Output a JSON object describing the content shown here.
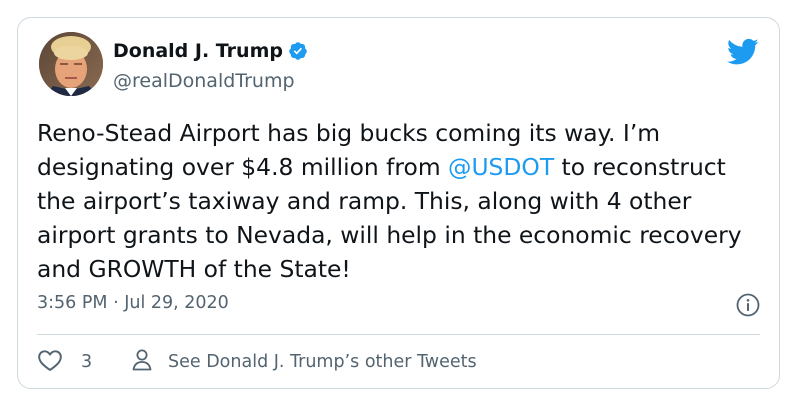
{
  "author": {
    "name": "Donald J. Trump",
    "handle": "@realDonaldTrump",
    "verified": true
  },
  "tweet": {
    "text_before": "Reno-Stead Airport has big bucks coming its way. I’m designating over $4.8 million from ",
    "mention": "@USDOT",
    "text_after": " to reconstruct the airport’s taxiway and ramp. This, along with 4 other airport grants to Nevada, will help in the economic recovery and GROWTH of the State!"
  },
  "meta": {
    "timestamp": "3:56 PM · Jul 29, 2020"
  },
  "actions": {
    "like_count": "3",
    "other_tweets_label": "See Donald J. Trump’s other Tweets"
  },
  "colors": {
    "accent": "#1d9bf0",
    "text": "#0f1419",
    "muted": "#536471",
    "border": "#cfd9de"
  },
  "icons": {
    "verified": "verified-badge-icon",
    "brand": "twitter-bird-icon",
    "info": "info-icon",
    "like": "heart-icon",
    "profile": "person-icon"
  }
}
